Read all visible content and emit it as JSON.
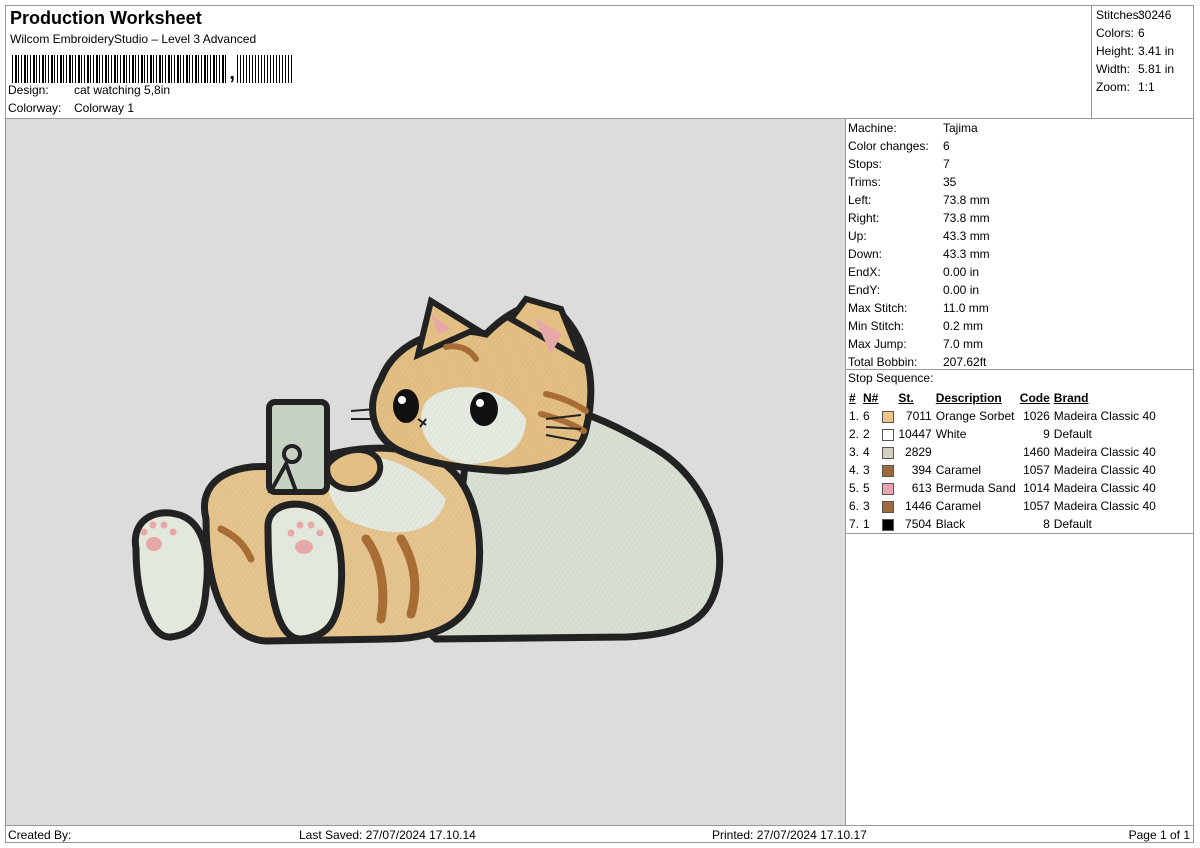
{
  "header": {
    "title": "Production Worksheet",
    "software": "Wilcom EmbroideryStudio – Level 3 Advanced",
    "design_label": "Design:",
    "design_value": "cat watching 5,8in",
    "colorway_label": "Colorway:",
    "colorway_value": "Colorway 1"
  },
  "summary": [
    {
      "label": "Stitches:",
      "value": "30246"
    },
    {
      "label": "Colors:",
      "value": "6"
    },
    {
      "label": "Height:",
      "value": "3.41 in"
    },
    {
      "label": "Width:",
      "value": "5.81 in"
    },
    {
      "label": "Zoom:",
      "value": "1:1"
    }
  ],
  "machine_info": [
    {
      "label": "Machine:",
      "value": "Tajima"
    },
    {
      "label": "Color changes:",
      "value": "6"
    },
    {
      "label": "Stops:",
      "value": "7"
    },
    {
      "label": "Trims:",
      "value": "35"
    },
    {
      "label": "Left:",
      "value": "73.8 mm"
    },
    {
      "label": "Right:",
      "value": "73.8 mm"
    },
    {
      "label": "Up:",
      "value": "43.3 mm"
    },
    {
      "label": "Down:",
      "value": "43.3 mm"
    },
    {
      "label": "EndX:",
      "value": "0.00 in"
    },
    {
      "label": "EndY:",
      "value": "0.00 in"
    },
    {
      "label": "Max Stitch:",
      "value": "11.0 mm"
    },
    {
      "label": "Min Stitch:",
      "value": "0.2 mm"
    },
    {
      "label": "Max Jump:",
      "value": "7.0 mm"
    },
    {
      "label": "Total Bobbin:",
      "value": "207.62ft"
    }
  ],
  "stop_sequence": {
    "title": "Stop Sequence:",
    "headers": {
      "num": "#",
      "n": "N#",
      "st": "St.",
      "desc": "Description",
      "code": "Code",
      "brand": "Brand"
    },
    "rows": [
      {
        "num": "1.",
        "n": "6",
        "color": "#f2c48a",
        "st": "7011",
        "desc": "Orange Sorbet",
        "code": "1026",
        "brand": "Madeira Classic 40"
      },
      {
        "num": "2.",
        "n": "2",
        "color": "#ffffff",
        "st": "10447",
        "desc": "White",
        "code": "9",
        "brand": "Default"
      },
      {
        "num": "3.",
        "n": "4",
        "color": "#d3d1c2",
        "st": "2829",
        "desc": "",
        "code": "1460",
        "brand": "Madeira Classic 40"
      },
      {
        "num": "4.",
        "n": "3",
        "color": "#a0693d",
        "st": "394",
        "desc": "Caramel",
        "code": "1057",
        "brand": "Madeira Classic 40"
      },
      {
        "num": "5.",
        "n": "5",
        "color": "#eba2b1",
        "st": "613",
        "desc": "Bermuda Sand",
        "code": "1014",
        "brand": "Madeira Classic 40"
      },
      {
        "num": "6.",
        "n": "3",
        "color": "#a0693d",
        "st": "1446",
        "desc": "Caramel",
        "code": "1057",
        "brand": "Madeira Classic 40"
      },
      {
        "num": "7.",
        "n": "1",
        "color": "#000000",
        "st": "7504",
        "desc": "Black",
        "code": "8",
        "brand": "Default"
      }
    ]
  },
  "footer": {
    "created_by": "Created By:",
    "last_saved": "Last Saved: 27/07/2024 17.10.14",
    "printed": "Printed: 27/07/2024 17.10.17",
    "page": "Page 1 of 1"
  }
}
